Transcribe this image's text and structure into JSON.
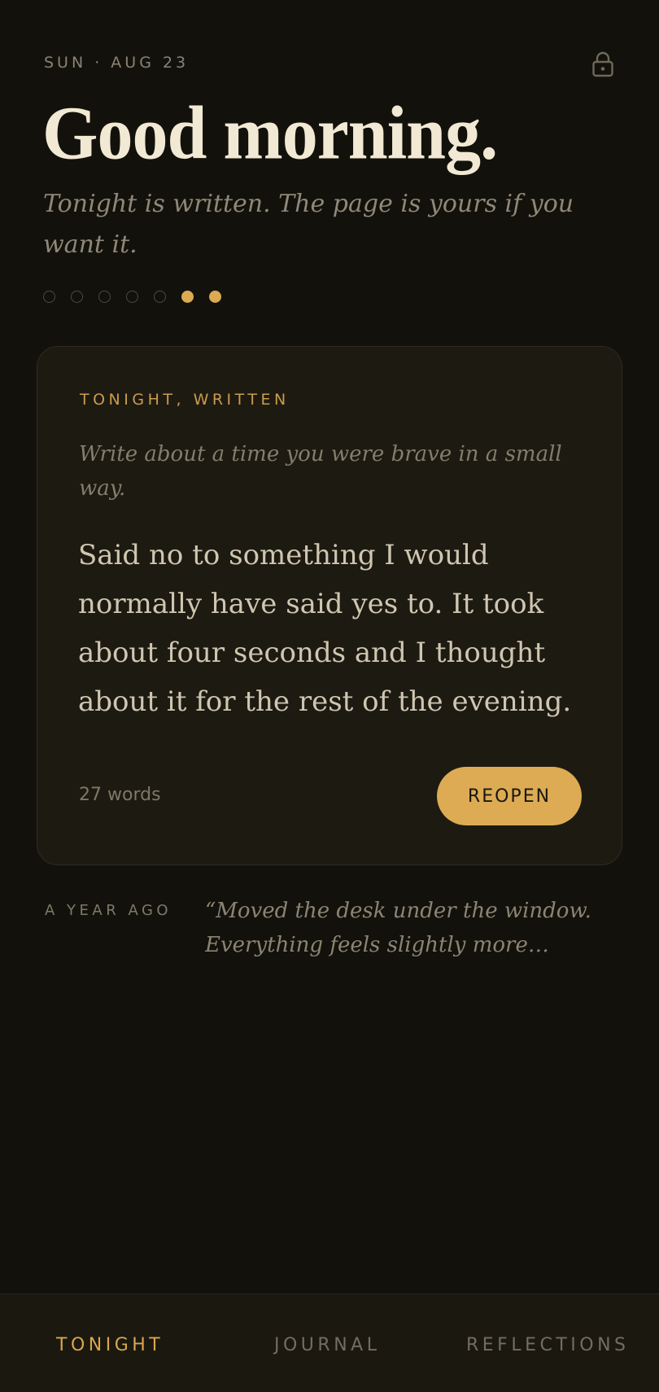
{
  "header": {
    "date": "SUN · AUG 23",
    "lock_icon": "lock-icon",
    "title": "Good morning.",
    "subtitle": "Tonight is written. The page is yours if you want it."
  },
  "progress_dots": {
    "total": 7,
    "filled": [
      5,
      6
    ]
  },
  "card": {
    "label": "TONIGHT, WRITTEN",
    "prompt": "Write about a time you were brave in a small way.",
    "entry": "Said no to something I would normally have said yes to. It took about four seconds and I thought about it for the rest of the evening.",
    "word_count": "27 words",
    "reopen_label": "REOPEN"
  },
  "memory": {
    "label": "A YEAR AGO",
    "quote": "“Moved the desk under the window. Everything feels slightly more possible"
  },
  "nav": {
    "items": [
      {
        "label": "TONIGHT",
        "active": true
      },
      {
        "label": "JOURNAL",
        "active": false
      },
      {
        "label": "REFLECTIONS",
        "active": false
      }
    ]
  },
  "colors": {
    "background": "#13110b",
    "card": "#1d1a11",
    "accent": "#dcab53",
    "text_primary": "#f1e9d4",
    "text_muted": "#8f8878"
  }
}
